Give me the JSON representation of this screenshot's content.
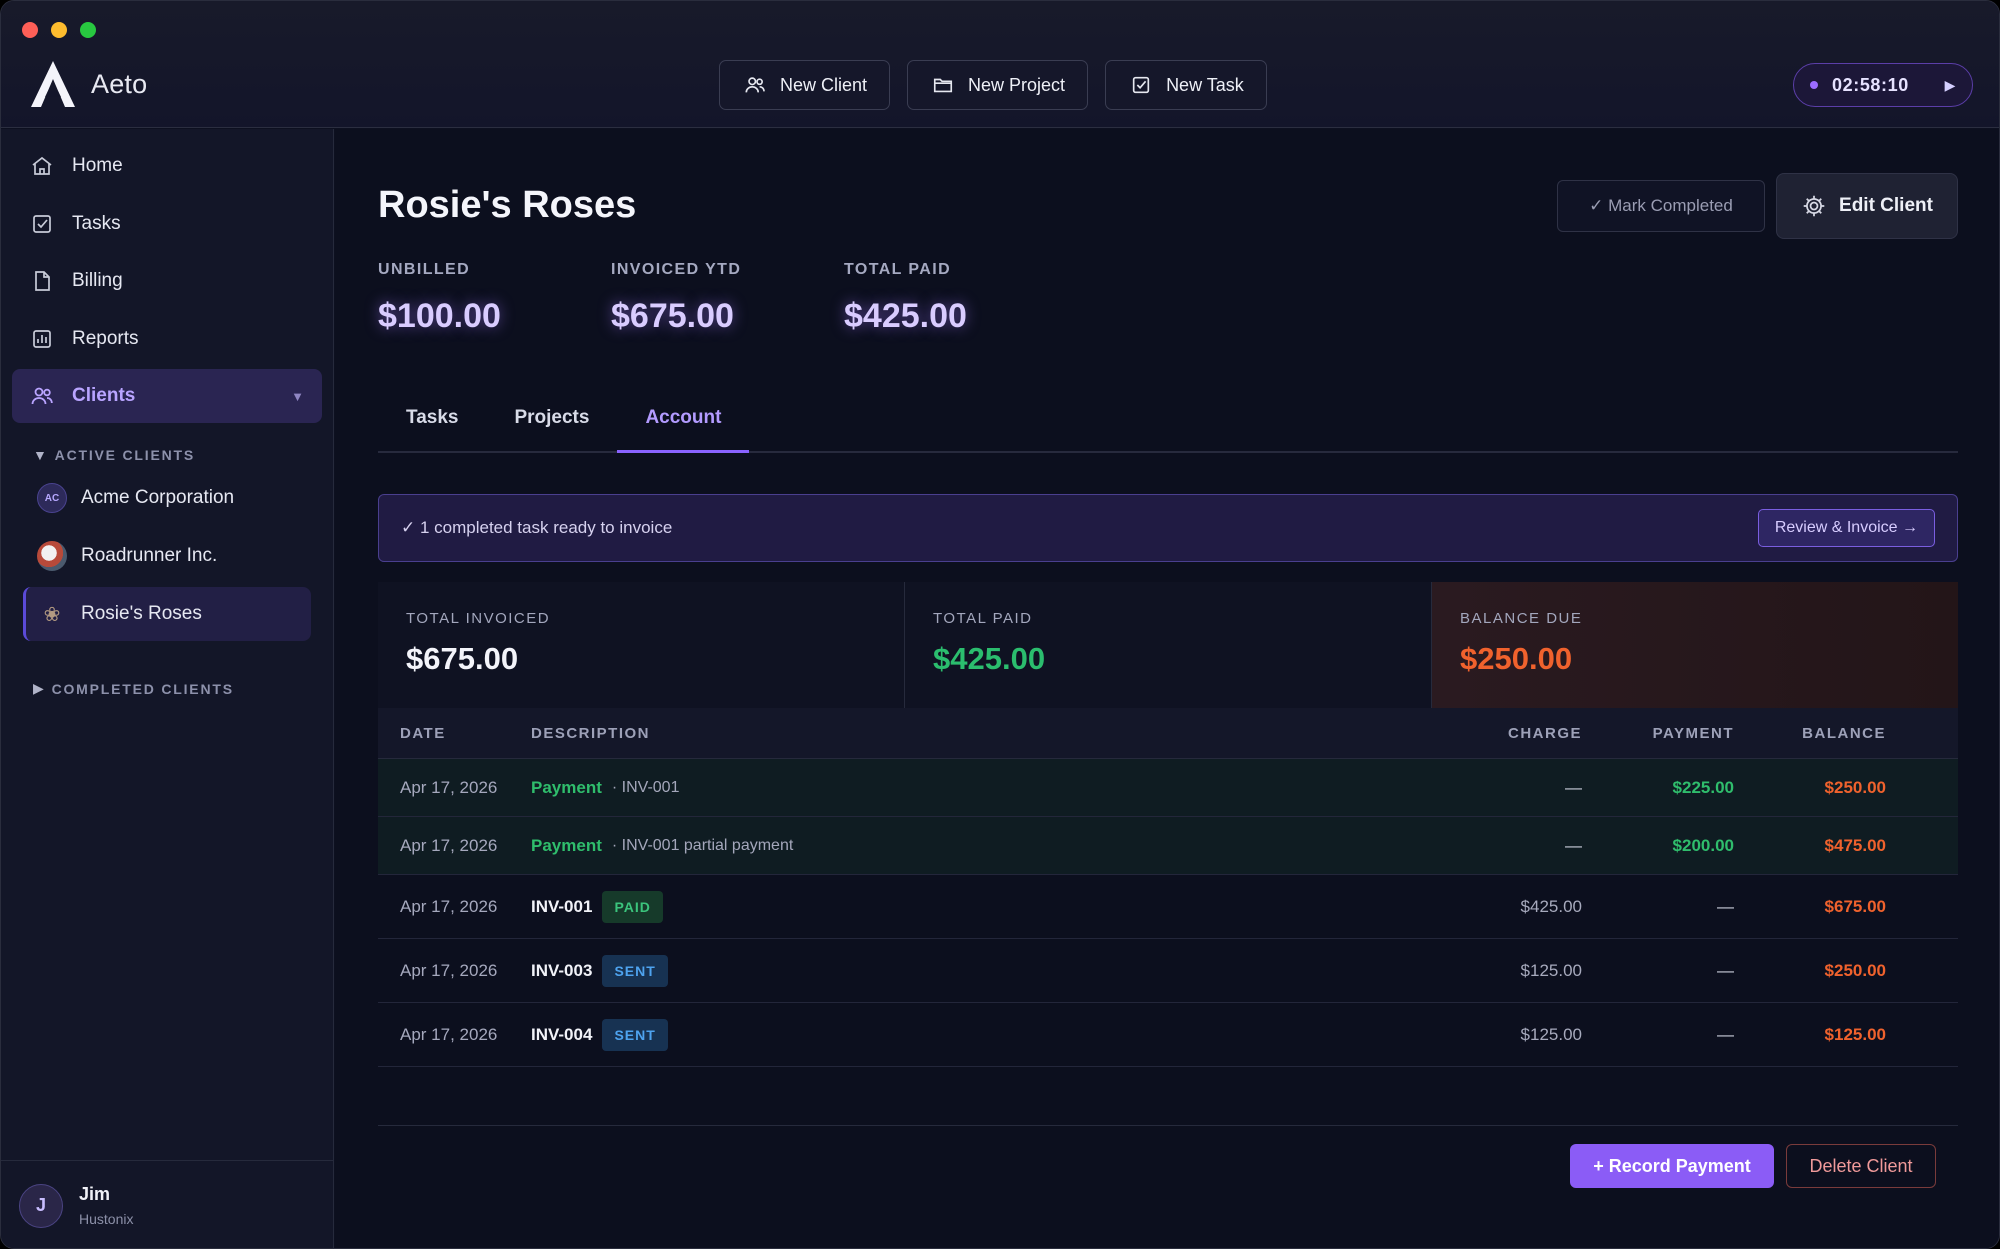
{
  "app": {
    "name": "Aeto"
  },
  "toolbar": {
    "new_client": "New Client",
    "new_project": "New Project",
    "new_task": "New Task",
    "timer": "02:58:10"
  },
  "sidebar": {
    "items": [
      {
        "label": "Home",
        "icon": "home-icon"
      },
      {
        "label": "Tasks",
        "icon": "checkbox-icon"
      },
      {
        "label": "Billing",
        "icon": "document-icon"
      },
      {
        "label": "Reports",
        "icon": "chart-icon"
      },
      {
        "label": "Clients",
        "icon": "users-icon"
      }
    ],
    "active_section": "ACTIVE CLIENTS",
    "clients": [
      {
        "name": "Acme Corporation",
        "initials": "AC"
      },
      {
        "name": "Roadrunner Inc."
      },
      {
        "name": "Rosie's Roses"
      }
    ],
    "completed_section": "COMPLETED CLIENTS",
    "user": {
      "initial": "J",
      "name": "Jim",
      "org": "Hustonix"
    }
  },
  "client": {
    "title": "Rosie's Roses",
    "mark_completed": "✓ Mark Completed",
    "edit": "Edit Client",
    "stats": [
      {
        "label": "UNBILLED",
        "value": "$100.00"
      },
      {
        "label": "INVOICED YTD",
        "value": "$675.00"
      },
      {
        "label": "TOTAL PAID",
        "value": "$425.00"
      }
    ]
  },
  "tabs": [
    "Tasks",
    "Projects",
    "Account"
  ],
  "active_tab": "Account",
  "banner": {
    "text": "✓ 1 completed task ready to invoice",
    "action": "Review & Invoice →"
  },
  "summary": [
    {
      "label": "TOTAL INVOICED",
      "value": "$675.00",
      "color": "#f3f4fa"
    },
    {
      "label": "TOTAL PAID",
      "value": "$425.00",
      "color": "#2bbd6e"
    },
    {
      "label": "BALANCE DUE",
      "value": "$250.00",
      "color": "#f0622d"
    }
  ],
  "ledger": {
    "headers": [
      "DATE",
      "DESCRIPTION",
      "CHARGE",
      "PAYMENT",
      "BALANCE"
    ],
    "payments": [
      {
        "date": "Apr 17, 2026",
        "label": "Payment",
        "note": "· INV-001",
        "charge": "—",
        "payment": "$225.00",
        "balance": "$250.00"
      },
      {
        "date": "Apr 17, 2026",
        "label": "Payment",
        "note": "· INV-001 partial payment",
        "charge": "—",
        "payment": "$200.00",
        "balance": "$475.00"
      }
    ],
    "invoices": [
      {
        "date": "Apr 17, 2026",
        "code": "INV-001",
        "status": "PAID",
        "charge": "$425.00",
        "payment": "—",
        "balance": "$675.00"
      },
      {
        "date": "Apr 17, 2026",
        "code": "INV-003",
        "status": "SENT",
        "charge": "$125.00",
        "payment": "—",
        "balance": "$250.00"
      },
      {
        "date": "Apr 17, 2026",
        "code": "INV-004",
        "status": "SENT",
        "charge": "$125.00",
        "payment": "—",
        "balance": "$125.00"
      }
    ]
  },
  "actions": {
    "record_payment": "+ Record Payment",
    "delete_client": "Delete Client"
  }
}
